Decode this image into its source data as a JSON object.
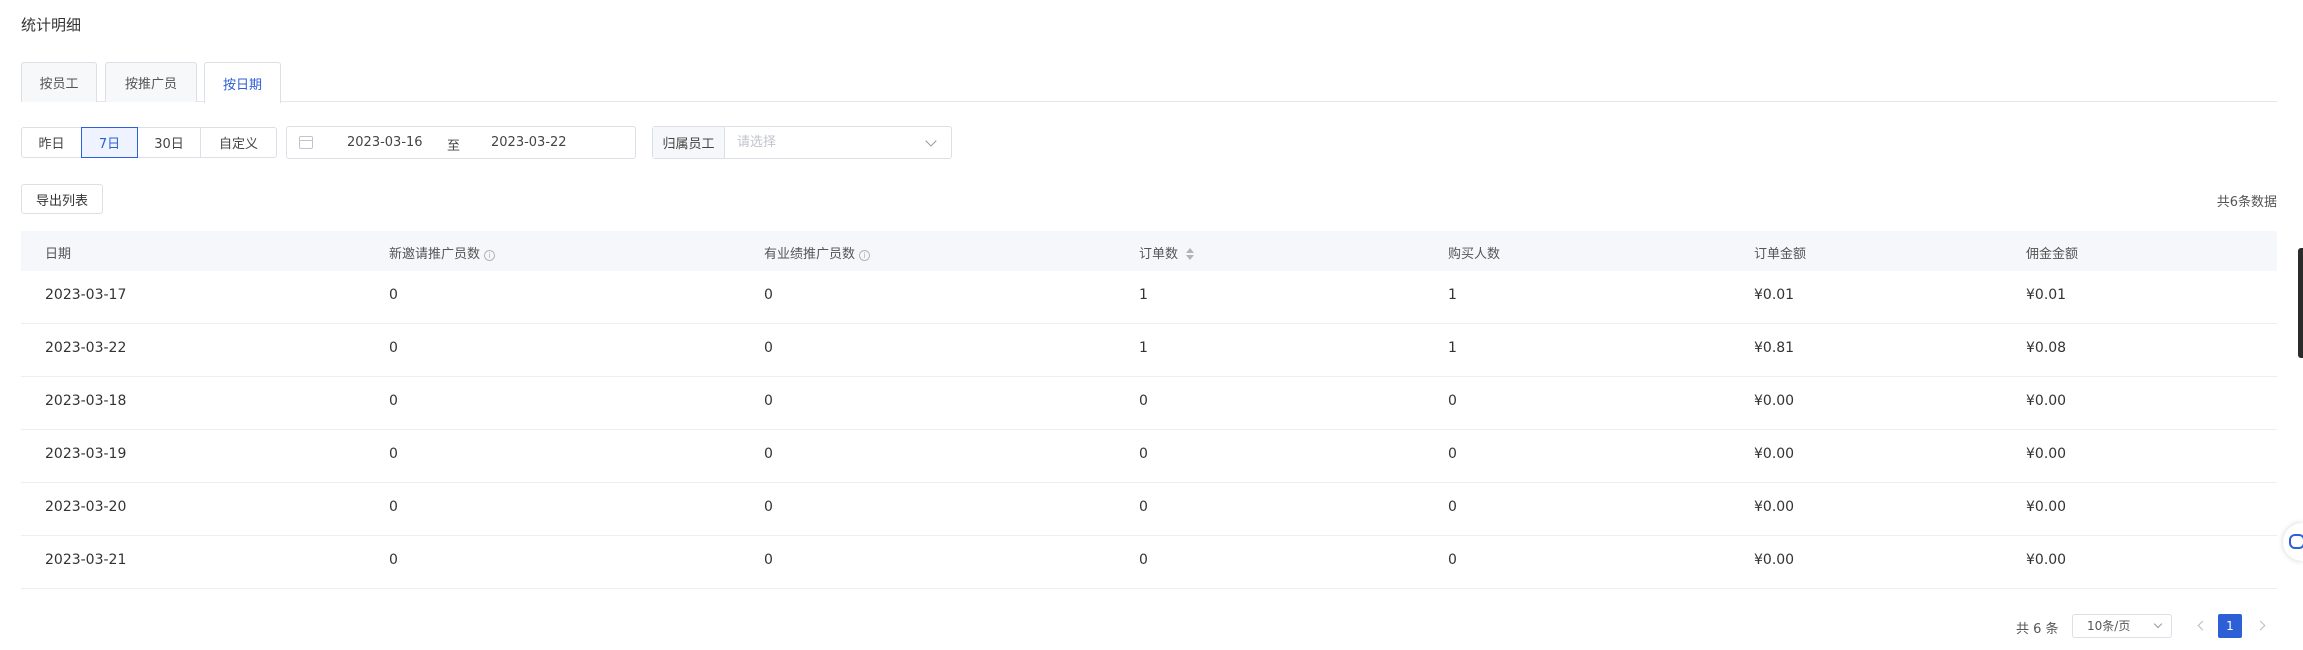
{
  "page": {
    "title": "统计明细"
  },
  "tabs": [
    {
      "label": "按员工",
      "active": false
    },
    {
      "label": "按推广员",
      "active": false
    },
    {
      "label": "按日期",
      "active": true
    }
  ],
  "range_buttons": [
    {
      "label": "昨日",
      "active": false
    },
    {
      "label": "7日",
      "active": true
    },
    {
      "label": "30日",
      "active": false
    },
    {
      "label": "自定义",
      "active": false
    }
  ],
  "date_range": {
    "start": "2023-03-16",
    "separator": "至",
    "end": "2023-03-22",
    "icon": "calendar-icon"
  },
  "employee_filter": {
    "label": "归属员工",
    "placeholder": "请选择",
    "icon": "chevron-down-icon"
  },
  "toolbar": {
    "export_label": "导出列表",
    "total_text": "共6条数据"
  },
  "table": {
    "columns": [
      "日期",
      "新邀请推广员数",
      "有业绩推广员数",
      "订单数",
      "购买人数",
      "订单金额",
      "佣金金额"
    ],
    "rows": [
      [
        "2023-03-17",
        "0",
        "0",
        "1",
        "1",
        "¥0.01",
        "¥0.01"
      ],
      [
        "2023-03-22",
        "0",
        "0",
        "1",
        "1",
        "¥0.81",
        "¥0.08"
      ],
      [
        "2023-03-18",
        "0",
        "0",
        "0",
        "0",
        "¥0.00",
        "¥0.00"
      ],
      [
        "2023-03-19",
        "0",
        "0",
        "0",
        "0",
        "¥0.00",
        "¥0.00"
      ],
      [
        "2023-03-20",
        "0",
        "0",
        "0",
        "0",
        "¥0.00",
        "¥0.00"
      ],
      [
        "2023-03-21",
        "0",
        "0",
        "0",
        "0",
        "¥0.00",
        "¥0.00"
      ]
    ]
  },
  "pagination": {
    "total_text": "共 6 条",
    "page_size": "10条/页",
    "current_page": "1"
  },
  "colors": {
    "accent": "#2d5fd6",
    "header_bg": "#f5f7fa",
    "border": "#dcdfe6"
  }
}
